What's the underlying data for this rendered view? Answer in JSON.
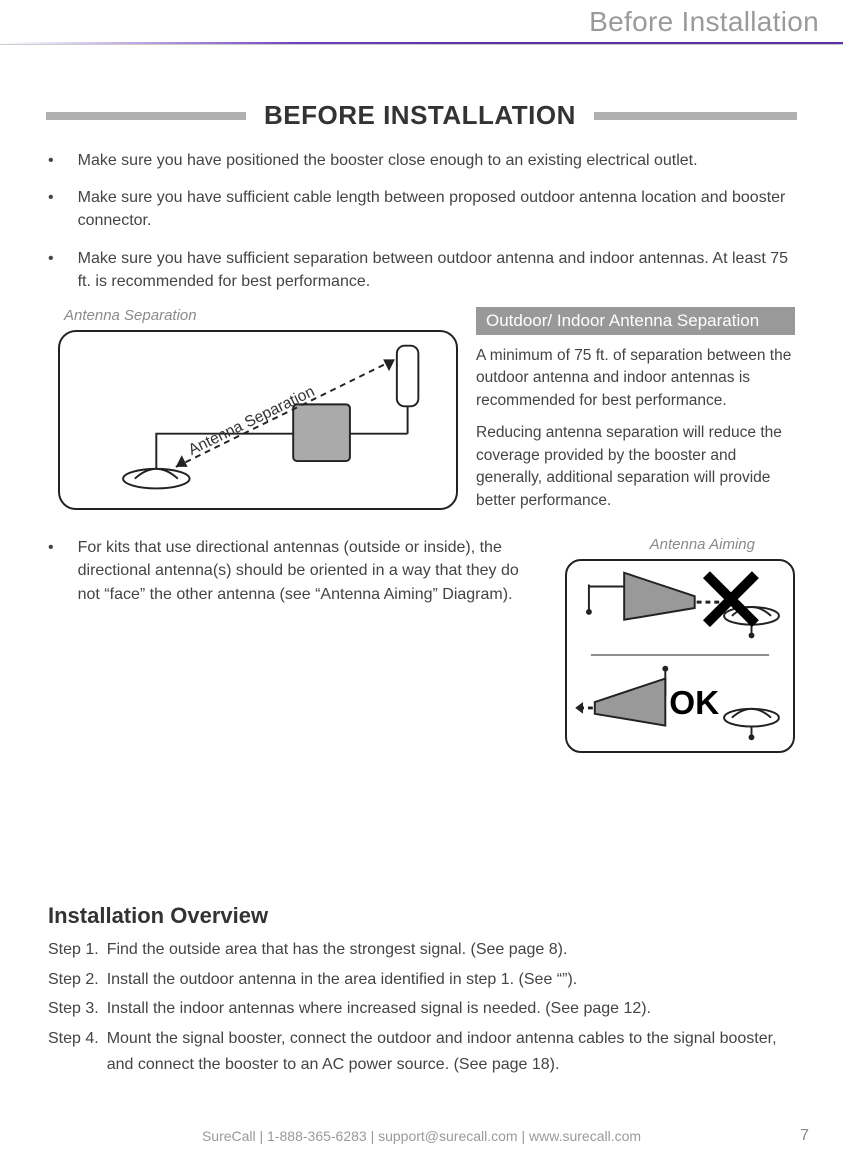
{
  "header": {
    "running_head": "Before Installation"
  },
  "section_title": "BEFORE INSTALLATION",
  "bullets_top": [
    "Make sure you have positioned the booster close enough to an existing electrical outlet.",
    "Make sure you have sufficient cable length between proposed outdoor antenna location and booster connector.",
    "Make sure you have sufficient separation between outdoor antenna and indoor antennas. At least 75 ft. is recommended for best performance."
  ],
  "fig1": {
    "caption": "Antenna Separation",
    "inline_label": "Antenna Separation"
  },
  "separation_box": {
    "title": "Outdoor/ Indoor Antenna Separation",
    "p1": "A minimum of 75 ft. of separation between the outdoor antenna and indoor antennas is recommended for best performance.",
    "p2": "Reducing antenna separation will reduce the coverage provided by the booster and generally, additional separation will provide better performance."
  },
  "bullets_mid": [
    "For kits that use directional antennas (outside or inside), the directional antenna(s) should be oriented in a way that they do not “face” the other antenna (see “Antenna Aiming” Diagram)."
  ],
  "fig2": {
    "caption": "Antenna Aiming",
    "ok_label": "OK"
  },
  "overview": {
    "heading": "Installation Overview",
    "steps": [
      {
        "label": "Step 1.",
        "body": "Find the outside area that has the strongest signal. (See page 8)."
      },
      {
        "label": "Step 2.",
        "body": "Install the outdoor antenna in the area identified in step 1. (See “”)."
      },
      {
        "label": "Step 3.",
        "body": "Install the indoor antennas where increased signal is needed. (See page 12)."
      },
      {
        "label": "Step 4.",
        "body": "Mount the signal booster, connect the outdoor and indoor antenna cables to the signal booster, and connect the booster to an AC power source. (See page 18)."
      }
    ]
  },
  "footer": {
    "text": "SureCall  |  1-888-365-6283  |  support@surecall.com  |  www.surecall.com",
    "page_number": "7"
  }
}
